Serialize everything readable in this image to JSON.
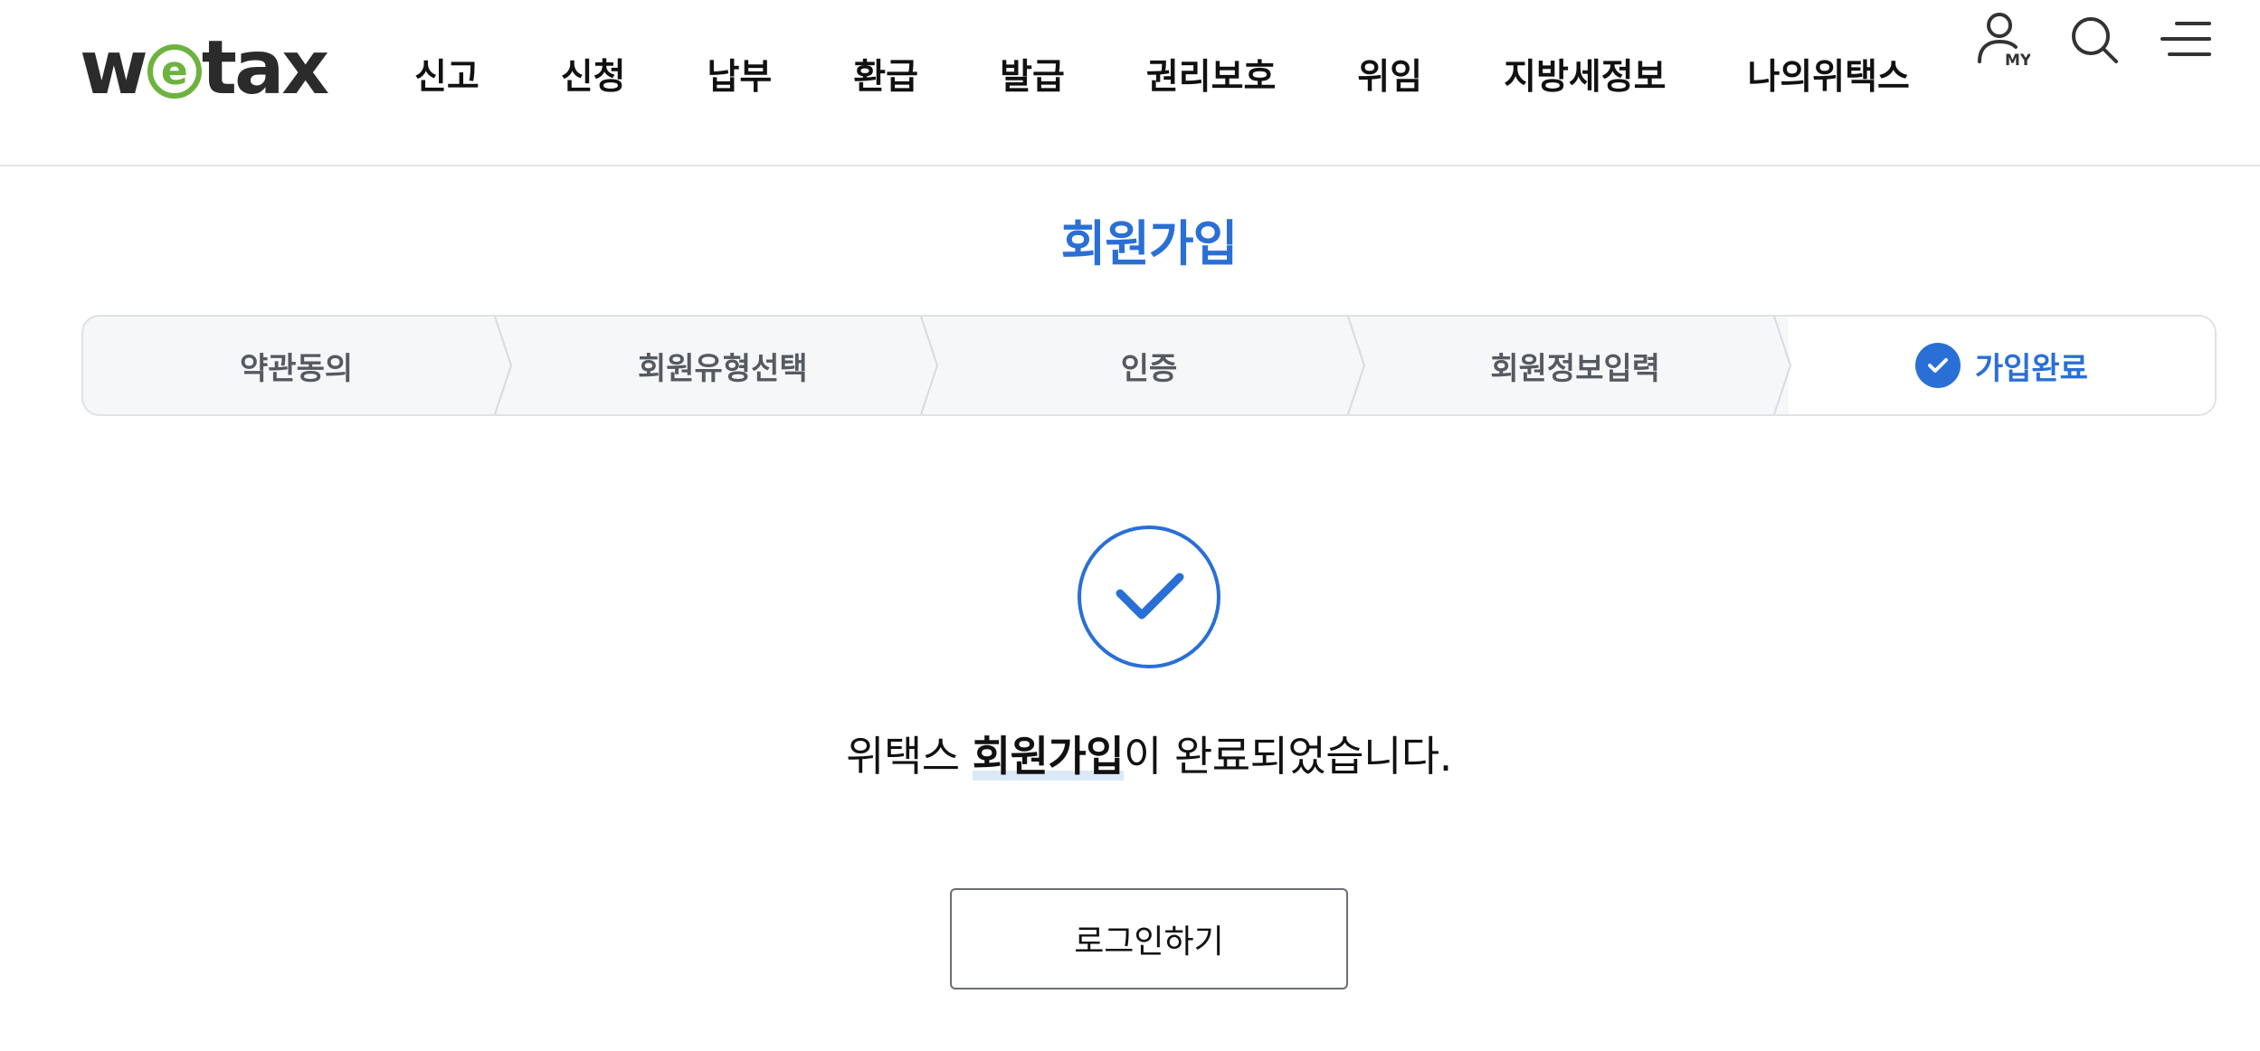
{
  "header": {
    "logo": {
      "prefix": "w",
      "e": "e",
      "suffix": "tax"
    },
    "nav": [
      {
        "label": "신고"
      },
      {
        "label": "신청"
      },
      {
        "label": "납부"
      },
      {
        "label": "환급"
      },
      {
        "label": "발급"
      },
      {
        "label": "권리보호"
      },
      {
        "label": "위임"
      },
      {
        "label": "지방세정보"
      },
      {
        "label": "나의위택스"
      }
    ],
    "utility": {
      "my_badge": "MY"
    },
    "icons": [
      "user-my-icon",
      "search-icon",
      "menu-icon"
    ]
  },
  "page": {
    "title": "회원가입"
  },
  "steps": [
    {
      "label": "약관동의",
      "active": false
    },
    {
      "label": "회원유형선택",
      "active": false
    },
    {
      "label": "인증",
      "active": false
    },
    {
      "label": "회원정보입력",
      "active": false
    },
    {
      "label": "가입완료",
      "active": true
    }
  ],
  "completion": {
    "message_prefix": "위택스 ",
    "message_highlight": "회원가입",
    "message_suffix": "이 완료되었습니다.",
    "button_label": "로그인하기"
  },
  "colors": {
    "accent": "#2a6fd6",
    "logo_green": "#6db33f",
    "step_bg": "#f6f7f9",
    "border": "#dfe2e6"
  }
}
